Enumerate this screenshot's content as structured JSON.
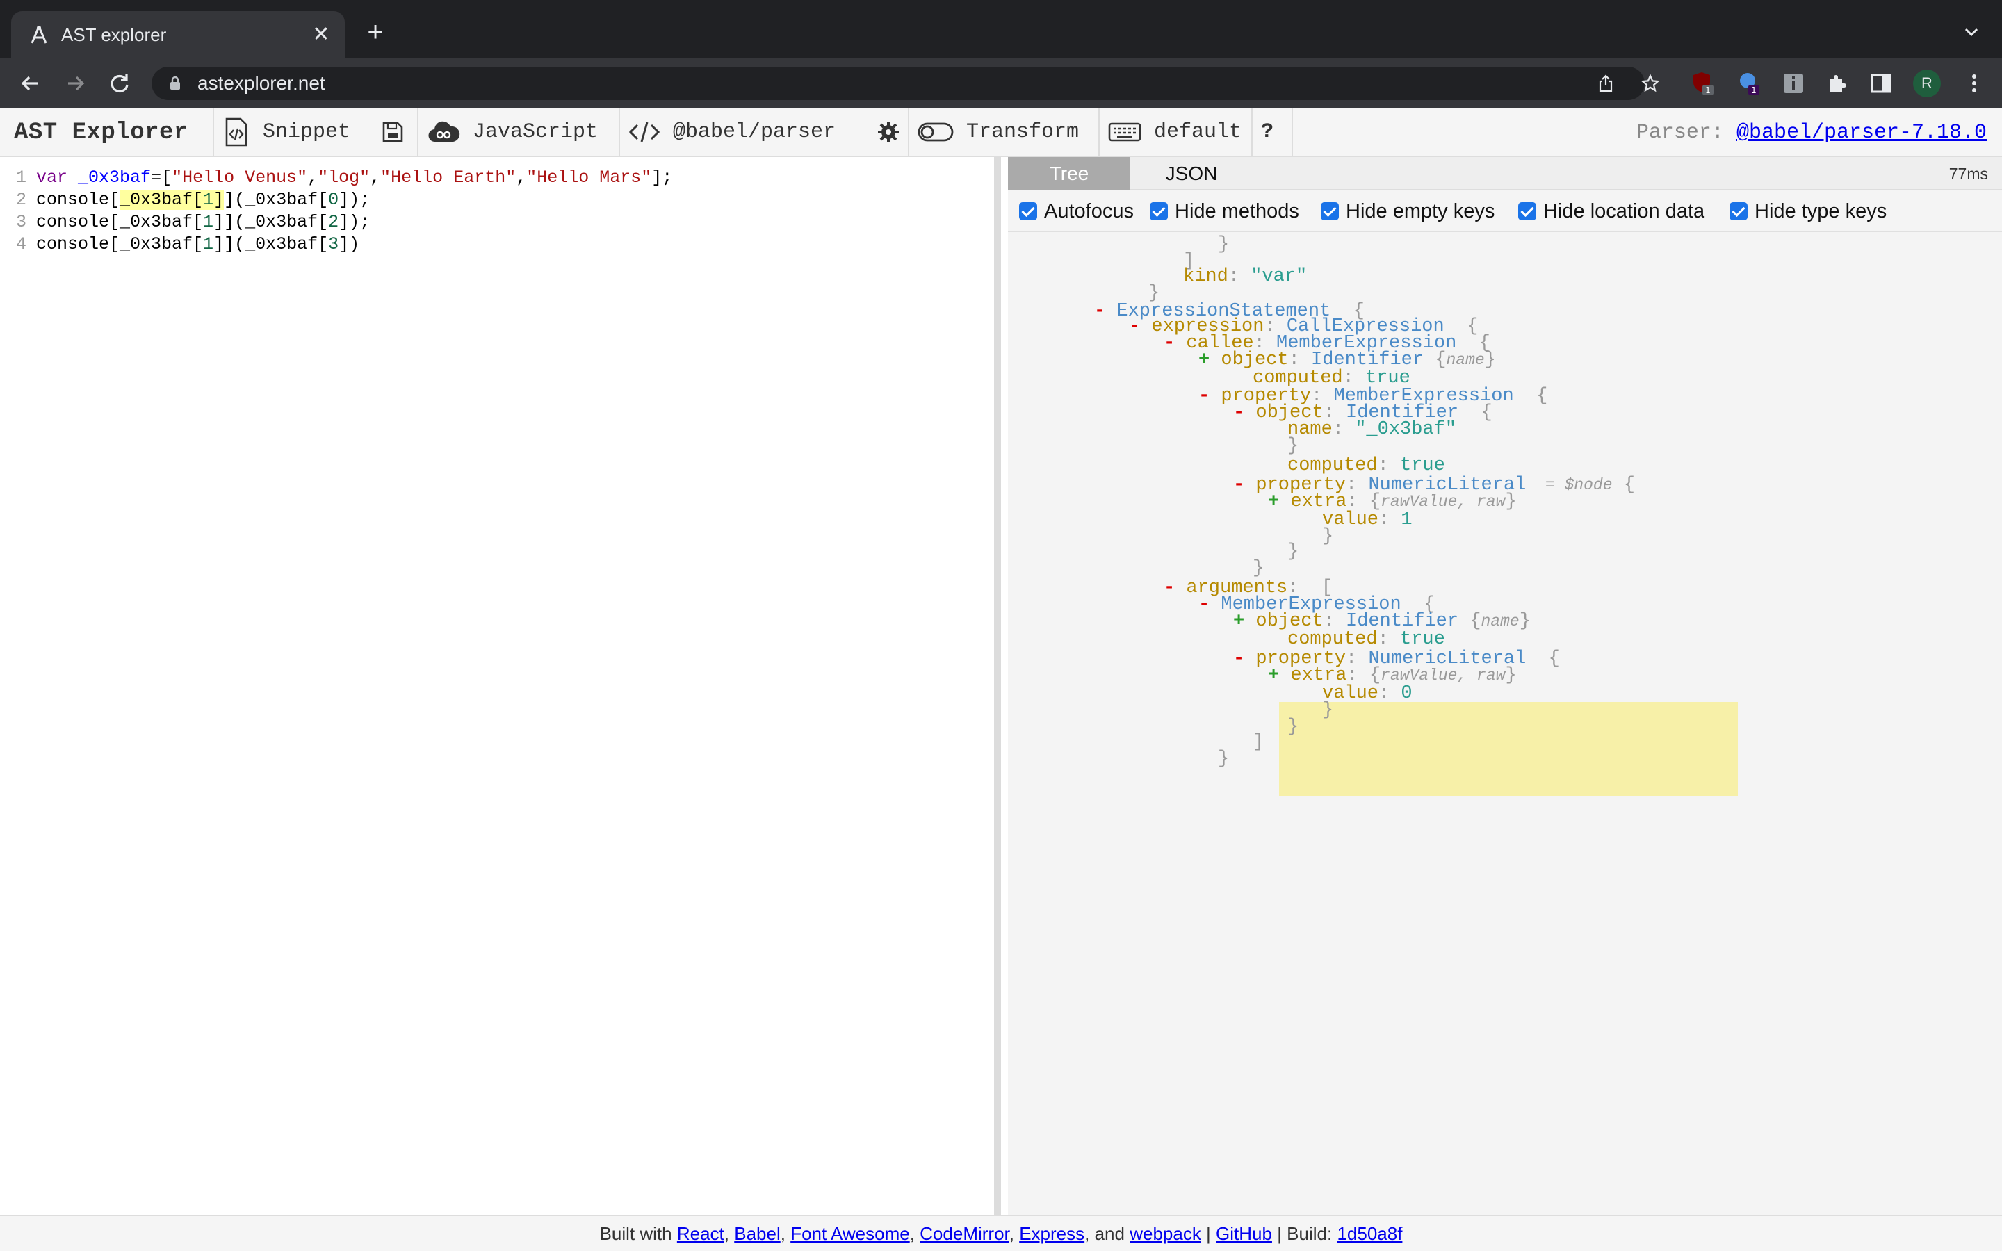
{
  "browser": {
    "tab_title": "AST explorer",
    "url": "astexplorer.net",
    "ext_badge_1": "1",
    "ext_badge_2": "1",
    "avatar_letter": "R"
  },
  "toolbar": {
    "brand": "AST Explorer",
    "snippet": "Snippet",
    "language": "JavaScript",
    "parser": "@babel/parser",
    "transform": "Transform",
    "keymap": "default",
    "help": "?",
    "parser_label": "Parser:",
    "parser_version": "@babel/parser-7.18.0"
  },
  "editor": {
    "lines": [
      {
        "n": "1",
        "tokens": [
          [
            "kw",
            "var"
          ],
          [
            "",
            " "
          ],
          [
            "def",
            "_0x3baf"
          ],
          [
            "",
            "=["
          ],
          [
            "str",
            "\"Hello Venus\""
          ],
          [
            "",
            ","
          ],
          [
            "str",
            "\"log\""
          ],
          [
            "",
            ","
          ],
          [
            "str",
            "\"Hello Earth\""
          ],
          [
            "",
            ","
          ],
          [
            "str",
            "\"Hello Mars\""
          ],
          [
            "",
            "];"
          ]
        ]
      },
      {
        "n": "2",
        "tokens": [
          [
            "",
            "console["
          ],
          [
            "mark",
            "_0x3baf["
          ],
          [
            "mark num",
            "1"
          ],
          [
            "mark",
            "]"
          ],
          [
            "",
            "](_0x3baf["
          ],
          [
            "num",
            "0"
          ],
          [
            "",
            "]);"
          ]
        ]
      },
      {
        "n": "3",
        "tokens": [
          [
            "",
            "console[_0x3baf["
          ],
          [
            "num",
            "1"
          ],
          [
            "",
            "]](_0x3baf["
          ],
          [
            "num",
            "2"
          ],
          [
            "",
            "]);"
          ]
        ]
      },
      {
        "n": "4",
        "tokens": [
          [
            "",
            "console[_0x3baf["
          ],
          [
            "num",
            "1"
          ],
          [
            "",
            "]](_0x3baf["
          ],
          [
            "num",
            "3"
          ],
          [
            "",
            "])"
          ]
        ]
      }
    ]
  },
  "ast": {
    "tabs": [
      "Tree",
      "JSON"
    ],
    "timing": "77ms",
    "options": [
      "Autofocus",
      "Hide methods",
      "Hide empty keys",
      "Hide location data",
      "Hide type keys"
    ],
    "tree_lines": [
      {
        "d": 0,
        "t": [
          [
            "tg",
            "}"
          ]
        ]
      },
      {
        "d": -1,
        "t": [
          [
            "tg",
            "]"
          ]
        ]
      },
      {
        "d": -1,
        "t": [
          [
            "tk",
            "kind"
          ],
          [
            "tg",
            ": "
          ],
          [
            "ts",
            "\"var\""
          ]
        ]
      },
      {
        "d": -2,
        "t": [
          [
            "tg",
            "}"
          ]
        ]
      },
      {
        "d": -3,
        "t": [
          [
            "tm",
            "- "
          ],
          [
            "tt",
            "ExpressionStatement"
          ],
          [
            "tg",
            "  {"
          ]
        ]
      },
      {
        "d": -2,
        "t": [
          [
            "tm",
            "- "
          ],
          [
            "tk",
            "expression"
          ],
          [
            "tg",
            ": "
          ],
          [
            "tt",
            "CallExpression"
          ],
          [
            "tg",
            "  {"
          ]
        ]
      },
      {
        "d": -1,
        "t": [
          [
            "tm",
            "- "
          ],
          [
            "tk",
            "callee"
          ],
          [
            "tg",
            ": "
          ],
          [
            "tt",
            "MemberExpression"
          ],
          [
            "tg",
            "  {"
          ]
        ]
      },
      {
        "d": 0,
        "t": [
          [
            "tp",
            "+ "
          ],
          [
            "tk",
            "object"
          ],
          [
            "tg",
            ": "
          ],
          [
            "tt",
            "Identifier"
          ],
          [
            "tg",
            " {"
          ],
          [
            "ti",
            "name"
          ],
          [
            "tg",
            "}"
          ]
        ]
      },
      {
        "d": 1,
        "t": [
          [
            "tk",
            "computed"
          ],
          [
            "tg",
            ": "
          ],
          [
            "tv",
            "true"
          ]
        ]
      },
      {
        "d": 0,
        "t": [
          [
            "tm",
            "- "
          ],
          [
            "tk",
            "property"
          ],
          [
            "tg",
            ": "
          ],
          [
            "tt",
            "MemberExpression"
          ],
          [
            "tg",
            "  {"
          ]
        ]
      },
      {
        "d": 1,
        "t": [
          [
            "tm",
            "- "
          ],
          [
            "tk",
            "object"
          ],
          [
            "tg",
            ": "
          ],
          [
            "tt",
            "Identifier"
          ],
          [
            "tg",
            "  {"
          ]
        ]
      },
      {
        "d": 2,
        "t": [
          [
            "tk",
            "name"
          ],
          [
            "tg",
            ": "
          ],
          [
            "ts",
            "\"_0x3baf\""
          ]
        ]
      },
      {
        "d": 2,
        "t": [
          [
            "tg",
            "}"
          ]
        ]
      },
      {
        "d": 2,
        "t": [
          [
            "tk",
            "computed"
          ],
          [
            "tg",
            ": "
          ],
          [
            "tv",
            "true"
          ]
        ]
      },
      {
        "d": 1,
        "t": [
          [
            "tm",
            "- "
          ],
          [
            "tk",
            "property"
          ],
          [
            "tg",
            ": "
          ],
          [
            "tt",
            "NumericLiteral"
          ],
          [
            "ti",
            "  = $node"
          ],
          [
            "tg",
            " {"
          ]
        ]
      },
      {
        "d": 2,
        "t": [
          [
            "tp",
            "+ "
          ],
          [
            "tk",
            "extra"
          ],
          [
            "tg",
            ": {"
          ],
          [
            "ti",
            "rawValue, raw"
          ],
          [
            "tg",
            "}"
          ]
        ]
      },
      {
        "d": 3,
        "t": [
          [
            "tk",
            "value"
          ],
          [
            "tg",
            ": "
          ],
          [
            "tv",
            "1"
          ]
        ]
      },
      {
        "d": 3,
        "t": [
          [
            "tg",
            "}"
          ]
        ]
      },
      {
        "d": 2,
        "t": [
          [
            "tg",
            "}"
          ]
        ]
      },
      {
        "d": 1,
        "t": [
          [
            "tg",
            "}"
          ]
        ]
      },
      {
        "d": -1,
        "t": [
          [
            "tm",
            "- "
          ],
          [
            "tk",
            "arguments"
          ],
          [
            "tg",
            ":  ["
          ]
        ]
      },
      {
        "d": 0,
        "t": [
          [
            "tm",
            "- "
          ],
          [
            "tt",
            "MemberExpression"
          ],
          [
            "tg",
            "  {"
          ]
        ]
      },
      {
        "d": 1,
        "t": [
          [
            "tp",
            "+ "
          ],
          [
            "tk",
            "object"
          ],
          [
            "tg",
            ": "
          ],
          [
            "tt",
            "Identifier"
          ],
          [
            "tg",
            " {"
          ],
          [
            "ti",
            "name"
          ],
          [
            "tg",
            "}"
          ]
        ]
      },
      {
        "d": 2,
        "t": [
          [
            "tk",
            "computed"
          ],
          [
            "tg",
            ": "
          ],
          [
            "tv",
            "true"
          ]
        ]
      },
      {
        "d": 1,
        "t": [
          [
            "tm",
            "- "
          ],
          [
            "tk",
            "property"
          ],
          [
            "tg",
            ": "
          ],
          [
            "tt",
            "NumericLiteral"
          ],
          [
            "tg",
            "  {"
          ]
        ]
      },
      {
        "d": 2,
        "t": [
          [
            "tp",
            "+ "
          ],
          [
            "tk",
            "extra"
          ],
          [
            "tg",
            ": {"
          ],
          [
            "ti",
            "rawValue, raw"
          ],
          [
            "tg",
            "}"
          ]
        ]
      },
      {
        "d": 3,
        "t": [
          [
            "tk",
            "value"
          ],
          [
            "tg",
            ": "
          ],
          [
            "tv",
            "0"
          ]
        ]
      },
      {
        "d": 3,
        "t": [
          [
            "tg",
            "}"
          ]
        ]
      },
      {
        "d": 2,
        "t": [
          [
            "tg",
            "}"
          ]
        ]
      },
      {
        "d": 1,
        "t": [
          [
            "tg",
            "]"
          ]
        ]
      },
      {
        "d": 0,
        "t": [
          [
            "tg",
            "}"
          ]
        ]
      }
    ]
  },
  "footer": {
    "built_with": "Built with",
    "links": [
      "React",
      "Babel",
      "Font Awesome",
      "CodeMirror",
      "Express",
      "webpack",
      "GitHub",
      "1d50a8f"
    ],
    "and": "and",
    "build_label": "Build:"
  }
}
